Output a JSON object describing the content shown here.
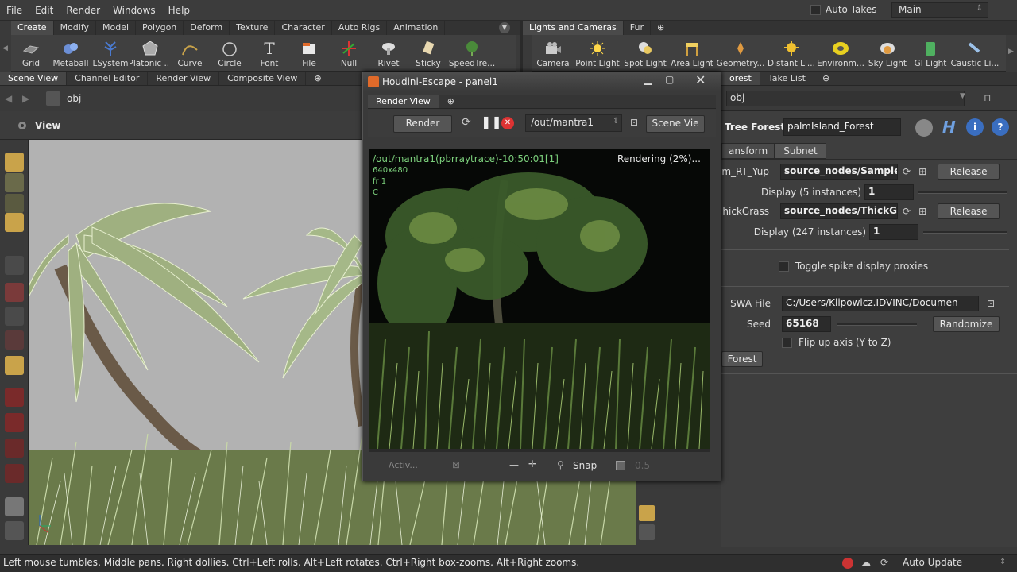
{
  "menu": [
    "File",
    "Edit",
    "Render",
    "Windows",
    "Help"
  ],
  "auto_takes": "Auto Takes",
  "desktop": "Main",
  "shelf_left_tabs": [
    "Create",
    "Modify",
    "Model",
    "Polygon",
    "Deform",
    "Texture",
    "Character",
    "Auto Rigs",
    "Animation"
  ],
  "shelf_left_tools": [
    "Grid",
    "Metaball",
    "LSystem",
    "Platonic ...",
    "Curve",
    "Circle",
    "Font",
    "File",
    "Null",
    "Rivet",
    "Sticky",
    "SpeedTre..."
  ],
  "shelf_right_tabs": [
    "Lights and Cameras",
    "Fur"
  ],
  "shelf_right_tools": [
    "Camera",
    "Point Light",
    "Spot Light",
    "Area Light",
    "Geometry...",
    "Distant Li...",
    "Environm...",
    "Sky Light",
    "GI Light",
    "Caustic Li..."
  ],
  "left_pane_tabs": [
    "Scene View",
    "Channel Editor",
    "Render View",
    "Composite View"
  ],
  "path": "obj",
  "view_label": "View",
  "right_pane_tabs": [
    "orest",
    "Take List"
  ],
  "right_path": "obj",
  "node": {
    "type_label": "Tree Forest",
    "name": "palmIsland_Forest"
  },
  "parm_tabs": [
    "ansform",
    "Subnet"
  ],
  "parms": {
    "r1_label": "m_RT_Yup",
    "r1_value": "source_nodes/SampleP",
    "release": "Release",
    "r2_label": "Display (5 instances)",
    "r2_value": "1",
    "r3_label": "hickGrass",
    "r3_value": "source_nodes/ThickGr",
    "r4_label": "Display (247 instances)",
    "r4_value": "1",
    "toggle_spike": "Toggle spike display proxies",
    "swa_label": "SWA File",
    "swa_value": "C:/Users/Klipowicz.IDVINC/Documen",
    "seed_label": "Seed",
    "seed_value": "65168",
    "randomize": "Randomize",
    "flip": "Flip up axis (Y to Z)",
    "forest_btn": "Forest"
  },
  "render_window": {
    "title": "Houdini-Escape - panel1",
    "tab": "Render View",
    "render_btn": "Render",
    "rop": "/out/mantra1",
    "scene_view": "Scene Vie",
    "overlay_title": "/out/mantra1(pbrraytrace)-10:50:01[1]",
    "overlay_res": "640x480",
    "overlay_fr": "fr 1",
    "overlay_c": "C",
    "progress": "Rendering (2%)...",
    "active": "Activ...",
    "snap": "Snap",
    "gamma": "0.5"
  },
  "status": "Left mouse tumbles. Middle pans. Right dollies. Ctrl+Left rolls. Alt+Left rotates. Ctrl+Right box-zooms. Alt+Right zooms.",
  "auto_update": "Auto Update"
}
